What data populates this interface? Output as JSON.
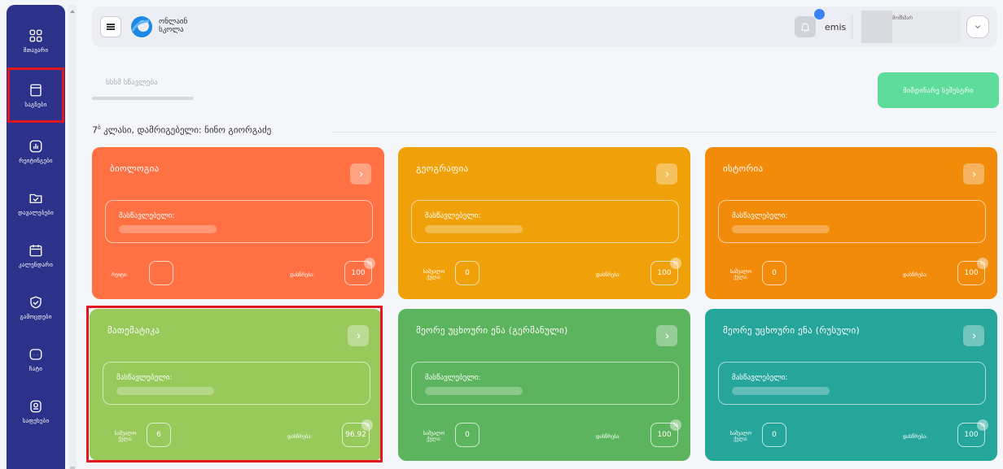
{
  "sidebar": {
    "items": [
      {
        "label": "მთავარი",
        "icon": "grid-icon"
      },
      {
        "label": "საგნები",
        "icon": "book-icon",
        "active": true
      },
      {
        "label": "რეიტინგები",
        "icon": "chart-icon"
      },
      {
        "label": "დავალებები",
        "icon": "folder-check-icon"
      },
      {
        "label": "კალენდარი",
        "icon": "calendar-icon"
      },
      {
        "label": "გამოცდები",
        "icon": "shield-check-icon"
      },
      {
        "label": "ჩატი",
        "icon": "chat-icon"
      },
      {
        "label": "საფეხები",
        "icon": "certificate-icon"
      }
    ]
  },
  "header": {
    "logo_line1": "ონლაინ",
    "logo_line2": "სკოლა",
    "username": "emis",
    "user_role": "მომხმარ"
  },
  "tabs": {
    "active_label": "სსსმ სწავლება"
  },
  "semester_button": "მიმდინარე სემესტრი",
  "class_title": {
    "grade": "7",
    "sup": "ბ",
    "rest": " კლასი, დამრიგებელი: ნინო გიორგაძე"
  },
  "cards": [
    {
      "subject": "ბიოლოგია",
      "teacher_label": "მასწავლებელი:",
      "left_label": "რეიტი:",
      "left_value": "",
      "right_label": "დასწრება:",
      "right_value": "100",
      "pct": "%",
      "color": "#ff7043"
    },
    {
      "subject": "გეოგრაფია",
      "teacher_label": "მასწავლებელი:",
      "left_label": "საშუალო ქულა:",
      "left_value": "0",
      "right_label": "დასწრება:",
      "right_value": "100",
      "pct": "%",
      "color": "#f0a10a"
    },
    {
      "subject": "ისტორია",
      "teacher_label": "მასწავლებელი:",
      "left_label": "საშუალო ქულა:",
      "left_value": "0",
      "right_label": "დასწრება:",
      "right_value": "100",
      "pct": "%",
      "color": "#f28a0a"
    },
    {
      "subject": "მათემატიკა",
      "teacher_label": "მასწავლებელი:",
      "left_label": "საშუალო ქულა:",
      "left_value": "6",
      "right_label": "დასწრება:",
      "right_value": "96.92",
      "pct": "%",
      "color": "#97c95b"
    },
    {
      "subject": "მეორე უცხოური ენა (გერმანული)",
      "teacher_label": "მასწავლებელი:",
      "left_label": "საშუალო ქულა:",
      "left_value": "0",
      "right_label": "დასწრება:",
      "right_value": "100",
      "pct": "%",
      "color": "#5db45e"
    },
    {
      "subject": "მეორე უცხოური ენა (რუსული)",
      "teacher_label": "მასწავლებელი:",
      "left_label": "საშუალო ქულა:",
      "left_value": "0",
      "right_label": "დასწრება:",
      "right_value": "100",
      "pct": "%",
      "color": "#26a69a"
    }
  ]
}
